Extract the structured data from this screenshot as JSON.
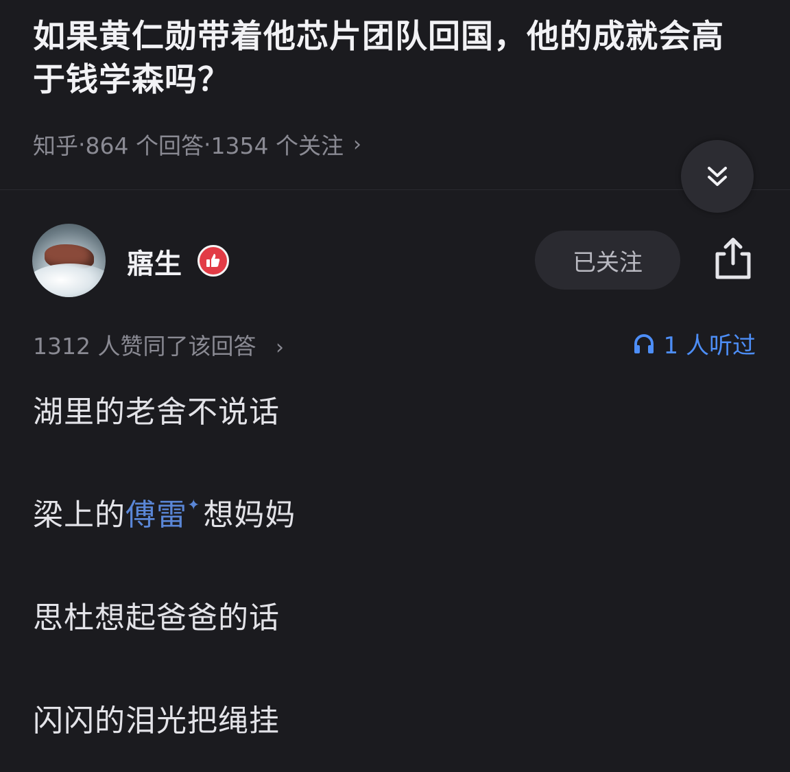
{
  "question": {
    "title": "如果黄仁勋带着他芯片团队回国，他的成就会高于钱学森吗？",
    "source": "知乎",
    "answers": "864 个回答",
    "followers": "1354 个关注",
    "separator": " · "
  },
  "icons": {
    "collapse": "double-chevron-down-icon",
    "badge": "thumbs-up-icon",
    "share": "share-icon",
    "listen": "headphones-icon"
  },
  "author": {
    "name": "寤生",
    "follow_label": "已关注"
  },
  "answer": {
    "votes": "1312 人赞同了该回答",
    "listen": "1 人听过",
    "lines": [
      "湖里的老舍不说话",
      "梁上的",
      "想妈妈",
      "思杜想起爸爸的话",
      "闪闪的泪光把绳挂"
    ],
    "link_text": "傅雷",
    "link_mark": "✦"
  },
  "colors": {
    "background": "#1b1b1f",
    "accent": "#4d8ef7",
    "link": "#5a86d6",
    "badge": "#e23b45"
  }
}
